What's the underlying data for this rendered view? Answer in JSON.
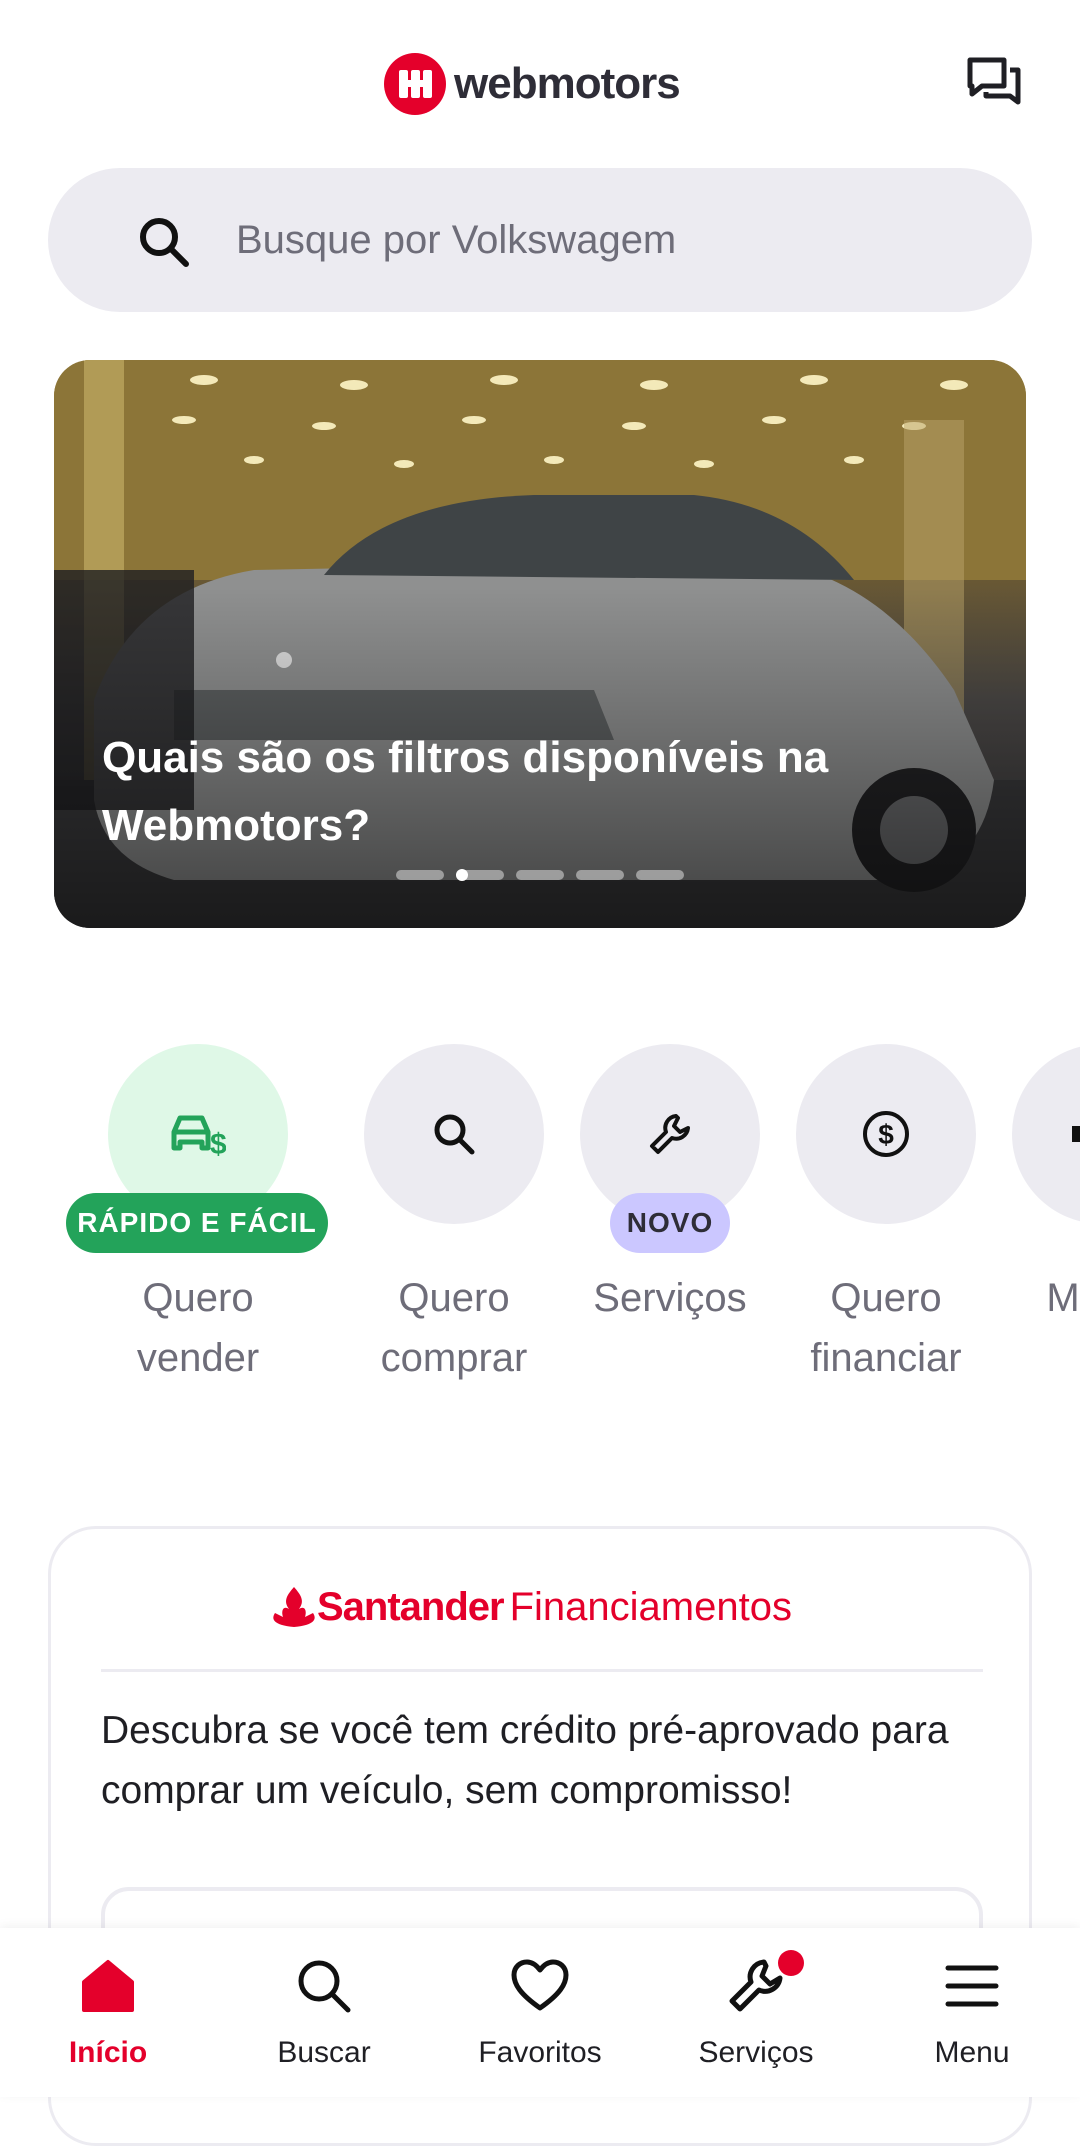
{
  "header": {
    "logo_text": "webmotors"
  },
  "search": {
    "placeholder": "Busque por Volkswagem"
  },
  "hero": {
    "title": "Quais são os filtros disponíveis na Webmotors?",
    "slide_count": 5,
    "active_slide": 1
  },
  "actions": [
    {
      "label": "Quero vender",
      "badge": "RÁPIDO E FÁCIL",
      "icon": "car-dollar-icon"
    },
    {
      "label": "Quero comprar",
      "icon": "search-icon"
    },
    {
      "label": "Serviços",
      "badge": "NOVO",
      "icon": "wrench-icon"
    },
    {
      "label": "Quero financiar",
      "icon": "dollar-circle-icon"
    },
    {
      "label": "M anú",
      "icon": "partial-icon"
    }
  ],
  "promo": {
    "brand": "Santander",
    "product": "Financiamentos",
    "text": "Descubra se você tem crédito pré-aprovado para comprar um veículo, sem compromisso!"
  },
  "nav": {
    "items": [
      {
        "label": "Início",
        "icon": "home-icon",
        "active": true
      },
      {
        "label": "Buscar",
        "icon": "search-icon"
      },
      {
        "label": "Favoritos",
        "icon": "heart-icon"
      },
      {
        "label": "Serviços",
        "icon": "wrench-icon",
        "notification": true
      },
      {
        "label": "Menu",
        "icon": "menu-icon"
      }
    ]
  },
  "colors": {
    "brand": "#e4002b",
    "surface": "#ecebf1",
    "success": "#23a35a",
    "new_badge": "#cbc7ff"
  }
}
